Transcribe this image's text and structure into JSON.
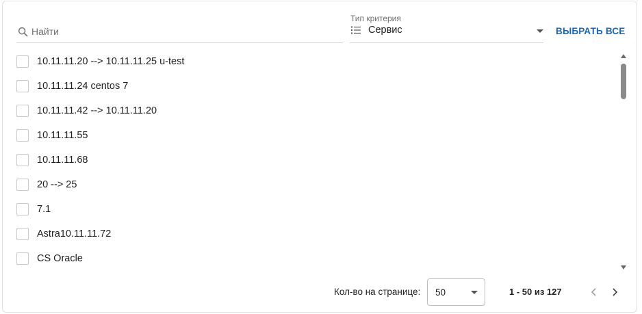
{
  "search": {
    "placeholder": "Найти",
    "value": ""
  },
  "criteria": {
    "label": "Тип критерия",
    "value": "Сервис"
  },
  "select_all_label": "ВЫБРАТЬ ВСЕ",
  "items": [
    {
      "label": "10.11.11.20 --> 10.11.11.25 u-test",
      "checked": false
    },
    {
      "label": "10.11.11.24 centos 7",
      "checked": false
    },
    {
      "label": "10.11.11.42 --> 10.11.11.20",
      "checked": false
    },
    {
      "label": "10.11.11.55",
      "checked": false
    },
    {
      "label": "10.11.11.68",
      "checked": false
    },
    {
      "label": "20 --> 25",
      "checked": false
    },
    {
      "label": "7.1",
      "checked": false
    },
    {
      "label": "Astra10.11.11.72",
      "checked": false
    },
    {
      "label": "CS Oracle",
      "checked": false
    }
  ],
  "pagination": {
    "per_page_label": "Кол-во на странице:",
    "per_page_value": "50",
    "range_text": "1 - 50 из 127"
  },
  "colors": {
    "accent": "#1565c0",
    "border": "#e0e0e0",
    "text": "#212121"
  }
}
